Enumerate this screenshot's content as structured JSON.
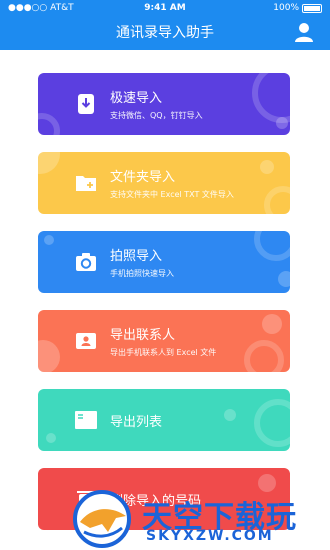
{
  "status_bar": {
    "carrier": "●●●○○ AT&T",
    "time": "9:41 AM",
    "battery": "100%"
  },
  "header": {
    "title": "通讯录导入助手",
    "user_icon": "user-icon"
  },
  "cards": [
    {
      "title": "极速导入",
      "subtitle": "支持微信、QQ，钉钉导入",
      "icon": "phone-download-icon",
      "color": "#5b3fe0"
    },
    {
      "title": "文件夹导入",
      "subtitle": "支持文件夹中 Excel TXT 文件导入",
      "icon": "folder-add-icon",
      "color": "#fcc84a"
    },
    {
      "title": "拍照导入",
      "subtitle": "手机拍照快速导入",
      "icon": "camera-icon",
      "color": "#2e88f2"
    },
    {
      "title": "导出联系人",
      "subtitle": "导出手机联系人到 Excel 文件",
      "icon": "contact-card-icon",
      "color": "#fb7355"
    },
    {
      "title": "导出列表",
      "subtitle": "",
      "icon": "list-sheet-icon",
      "color": "#3fd9bd"
    },
    {
      "title": "删除导入的号码",
      "subtitle": "",
      "icon": "delete-icon",
      "color": "#f04b4b"
    }
  ],
  "watermark": {
    "brand_cn": "天空下载玩",
    "brand_en": "SKYXZW.COM",
    "brand_color": "#1b64d8"
  }
}
